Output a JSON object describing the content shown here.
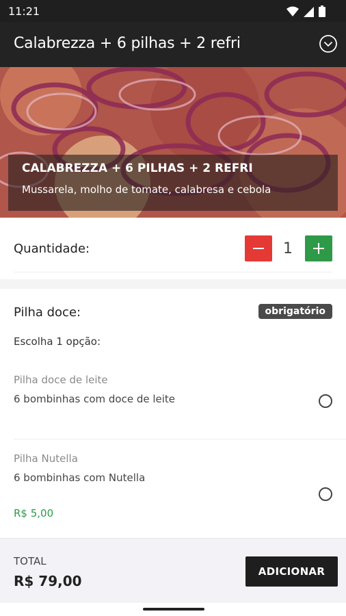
{
  "status_bar": {
    "time": "11:21",
    "icons": [
      "wifi-icon",
      "cellular-icon",
      "battery-icon"
    ]
  },
  "app_bar": {
    "title": "Calabrezza + 6 pilhas + 2 refri",
    "action_icon": "chevron-down-circle-icon"
  },
  "hero": {
    "name": "CALABREZZA + 6 PILHAS + 2 REFRI",
    "description": "Mussarela, molho de tomate, calabresa e cebola"
  },
  "quantity": {
    "label": "Quantidade:",
    "value": "1"
  },
  "group": {
    "title": "Pilha doce:",
    "badge": "obrigatório",
    "instruction": "Escolha 1 opção:",
    "options": [
      {
        "name": "Pilha doce de leite",
        "description": "6 bombinhas com doce de leite",
        "price": ""
      },
      {
        "name": "Pilha Nutella",
        "description": "6 bombinhas com Nutella",
        "price": "R$ 5,00"
      }
    ]
  },
  "footer": {
    "total_label": "TOTAL",
    "total_value": "R$ 79,00",
    "add_label": "ADICIONAR"
  },
  "colors": {
    "minus": "#e53935",
    "plus": "#2e9a48",
    "price": "#2e9a48",
    "appbar": "#232323"
  }
}
